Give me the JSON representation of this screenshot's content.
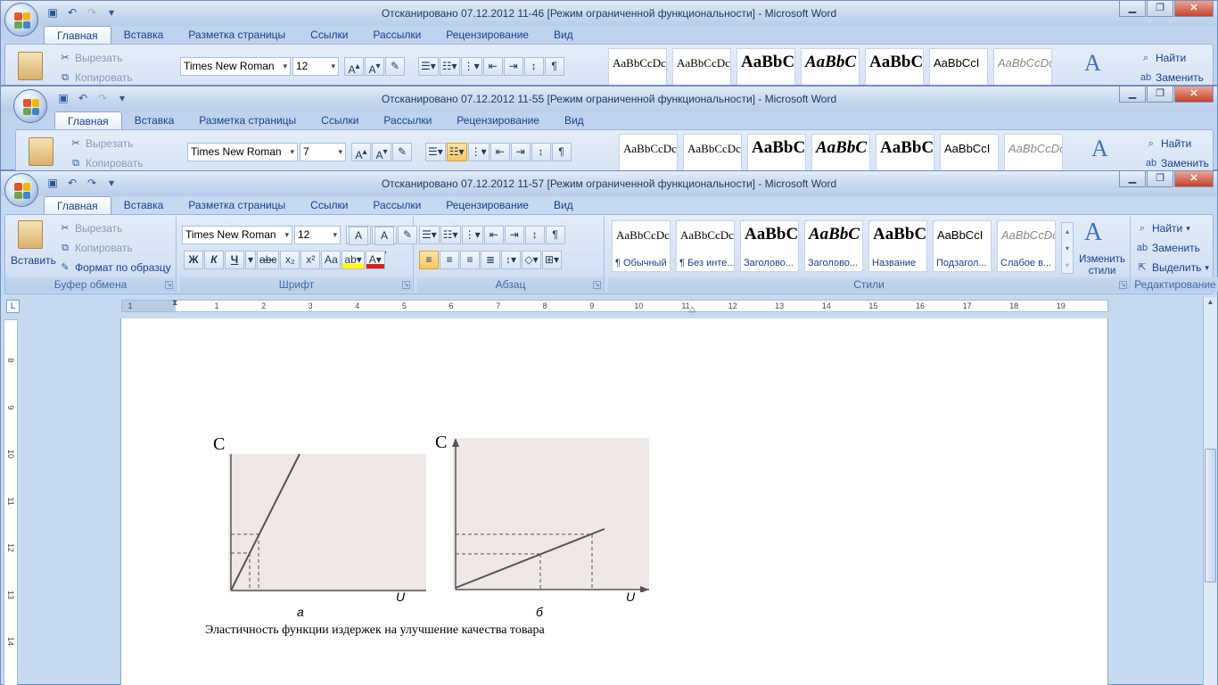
{
  "windows": [
    {
      "title": "Отсканировано 07.12.2012 11-46 [Режим ограниченной функциональности]  -  Microsoft Word",
      "font_name": "Times New Roman",
      "font_size": "12"
    },
    {
      "title": "Отсканировано 07.12.2012 11-55 [Режим ограниченной функциональности]  -  Microsoft Word",
      "font_name": "Times New Roman",
      "font_size": "7"
    },
    {
      "title": "Отсканировано 07.12.2012 11-57 [Режим ограниченной функциональности]  -  Microsoft Word",
      "font_name": "Times New Roman",
      "font_size": "12"
    }
  ],
  "tabs": [
    "Главная",
    "Вставка",
    "Разметка страницы",
    "Ссылки",
    "Рассылки",
    "Рецензирование",
    "Вид"
  ],
  "clipboard": {
    "paste": "Вставить",
    "cut": "Вырезать",
    "copy": "Копировать",
    "format_painter": "Формат по образцу",
    "label": "Буфер обмена"
  },
  "font_group": {
    "label": "Шрифт",
    "bold": "Ж",
    "italic": "К",
    "underline": "Ч",
    "strike": "abc",
    "sub": "x₂",
    "sup": "x²",
    "case": "Аа",
    "grow": "A",
    "shrink": "A"
  },
  "paragraph_group": {
    "label": "Абзац",
    "pilcrow": "¶"
  },
  "styles_group": {
    "label": "Стили",
    "change_styles": "Изменить стили",
    "items": [
      {
        "preview": "AaBbCcDc",
        "name": "¶ Обычный"
      },
      {
        "preview": "AaBbCcDc",
        "name": "¶ Без инте..."
      },
      {
        "preview": "AaBbC",
        "name": "Заголово..."
      },
      {
        "preview": "AaBbC",
        "name": "Заголово..."
      },
      {
        "preview": "AaBbC",
        "name": "Название"
      },
      {
        "preview": "AaBbCcI",
        "name": "Подзагол..."
      },
      {
        "preview": "AaBbCcDc",
        "name": "Слабое в..."
      }
    ]
  },
  "editing_group": {
    "label": "Редактирование",
    "find": "Найти",
    "replace": "Заменить",
    "select": "Выделить"
  },
  "ruler_numbers": [
    "1",
    "1",
    "2",
    "3",
    "4",
    "5",
    "6",
    "7",
    "8",
    "9",
    "10",
    "11",
    "12",
    "13",
    "14",
    "15",
    "16",
    "17",
    "18",
    "19"
  ],
  "vruler_numbers": [
    "8",
    "9",
    "10",
    "11",
    "12",
    "13",
    "14"
  ],
  "document": {
    "figure_a": {
      "y_label": "С",
      "x_label": "U",
      "sub_label": "а"
    },
    "figure_b": {
      "y_label": "С",
      "x_label": "U",
      "sub_label": "б"
    },
    "caption": "Эластичность функции издержек на улучшение качества товара"
  },
  "colors": {
    "ribbon": "#d3e1f4",
    "active_tab": "#ffffff",
    "page": "#ffffff",
    "figure_bg": "#efe8e6"
  }
}
